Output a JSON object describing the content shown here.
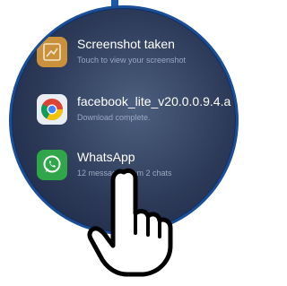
{
  "notifications": [
    {
      "title": "Screenshot taken",
      "subtitle": "Touch to view your screenshot",
      "icon": "screenshot-icon",
      "color": "#c9913c"
    },
    {
      "title": "facebook_lite_v20.0.0.9.4.a",
      "subtitle": "Download complete.",
      "icon": "chrome-icon",
      "color": "#e9eef4"
    },
    {
      "title": "WhatsApp",
      "subtitle": "12 messages from 2 chats",
      "icon": "whatsapp-icon",
      "color": "#2fa64a"
    }
  ],
  "pointer": {
    "icon": "pointing-hand-icon"
  },
  "colors": {
    "frame": "#1a4f97",
    "panel": "#2c3a58",
    "text": "#ffffff",
    "subtext": "#9aa8c0"
  }
}
